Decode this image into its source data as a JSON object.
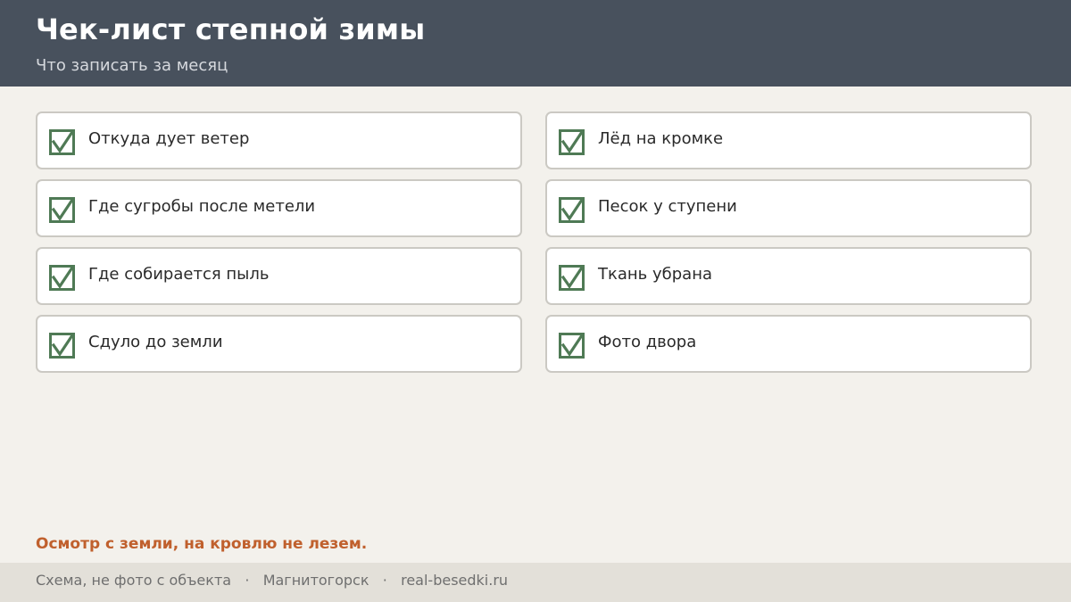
{
  "header": {
    "title": "Чек-лист степной зимы",
    "subtitle": "Что записать за месяц"
  },
  "checklist": {
    "items": [
      {
        "label": "Откуда дует ветер",
        "checked": true
      },
      {
        "label": "Лёд на кромке",
        "checked": true
      },
      {
        "label": "Где сугробы после метели",
        "checked": true
      },
      {
        "label": "Песок у ступени",
        "checked": true
      },
      {
        "label": "Где собирается пыль",
        "checked": true
      },
      {
        "label": "Ткань убрана",
        "checked": true
      },
      {
        "label": "Сдуло до земли",
        "checked": true
      },
      {
        "label": "Фото двора",
        "checked": true
      }
    ],
    "check_color": "#4f7a55"
  },
  "note": "Осмотр с земли, на кровлю не лезем.",
  "footer": {
    "disclaimer": "Схема, не фото с объекта",
    "city": "Магнитогорск",
    "site": "real-besedki.ru",
    "separator": "·"
  },
  "colors": {
    "header_bg": "#48515d",
    "page_bg": "#f3f1ec",
    "accent": "#c0602d",
    "footer_bg": "#e3e0d9"
  }
}
